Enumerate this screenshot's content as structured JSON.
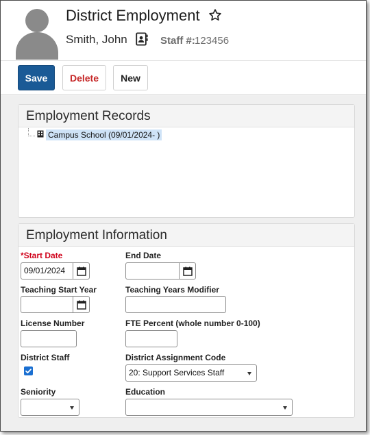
{
  "header": {
    "title": "District Employment",
    "person_name": "Smith, John",
    "staff_label": "Staff #:",
    "staff_number": "123456"
  },
  "toolbar": {
    "save_label": "Save",
    "delete_label": "Delete",
    "new_label": "New"
  },
  "employment_records": {
    "title": "Employment Records",
    "items": [
      {
        "label": "Campus School (09/01/2024- )",
        "icon": "building-icon",
        "selected": true
      }
    ]
  },
  "employment_info": {
    "title": "Employment Information",
    "start_date": {
      "label": "*Start Date",
      "value": "09/01/2024"
    },
    "end_date": {
      "label": "End Date",
      "value": ""
    },
    "teaching_start_year": {
      "label": "Teaching Start Year",
      "value": ""
    },
    "teaching_years_modifier": {
      "label": "Teaching Years Modifier",
      "value": ""
    },
    "license_number": {
      "label": "License Number",
      "value": ""
    },
    "fte_percent": {
      "label": "FTE Percent (whole number 0-100)",
      "value": ""
    },
    "district_staff": {
      "label": "District Staff",
      "checked": true
    },
    "district_assignment_code": {
      "label": "District Assignment Code",
      "value": "20: Support Services Staff"
    },
    "seniority": {
      "label": "Seniority",
      "value": ""
    },
    "education": {
      "label": "Education",
      "value": ""
    }
  },
  "colors": {
    "primary": "#1a5a96",
    "danger": "#c62828",
    "required": "#d0021b",
    "selection": "#cfe3f7",
    "checkbox": "#1a6fd1"
  }
}
